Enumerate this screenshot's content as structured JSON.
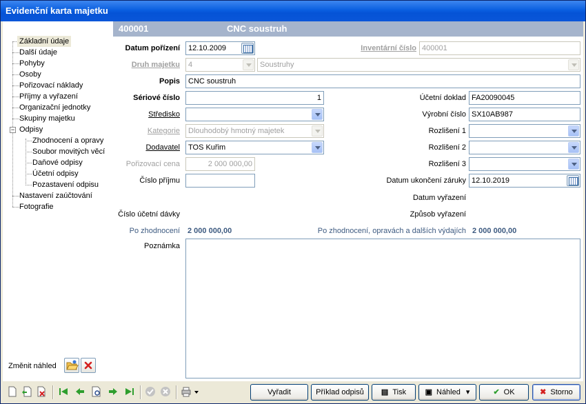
{
  "window": {
    "title": "Evidenční karta majetku"
  },
  "tree": {
    "items": [
      {
        "label": "Základní údaje",
        "selected": true
      },
      {
        "label": "Další údaje"
      },
      {
        "label": "Pohyby"
      },
      {
        "label": "Osoby"
      },
      {
        "label": "Pořizovací náklady"
      },
      {
        "label": "Příjmy a vyřazení"
      },
      {
        "label": "Organizační jednotky"
      },
      {
        "label": "Skupiny majetku"
      },
      {
        "label": "Odpisy",
        "expanded": true
      },
      {
        "label": "Zhodnocení a opravy"
      },
      {
        "label": "Soubor movitých věcí"
      },
      {
        "label": "Daňové odpisy"
      },
      {
        "label": "Účetní odpisy"
      },
      {
        "label": "Pozastavení odpisu"
      },
      {
        "label": "Nastavení zaúčtování"
      },
      {
        "label": "Fotografie"
      }
    ],
    "change_view_label": "Změnit náhled"
  },
  "header": {
    "number": "400001",
    "name": "CNC soustruh"
  },
  "form": {
    "datum_porizeni": {
      "label": "Datum pořízení",
      "value": "12.10.2009"
    },
    "inventarni_cislo": {
      "label": "Inventární číslo",
      "value": "400001"
    },
    "druh_majetku": {
      "label": "Druh majetku",
      "code": "4",
      "name": "Soustruhy"
    },
    "popis": {
      "label": "Popis",
      "value": "CNC soustruh"
    },
    "seriove_cislo": {
      "label": "Sériové číslo",
      "value": "1"
    },
    "ucetni_doklad": {
      "label": "Účetní doklad",
      "value": "FA20090045"
    },
    "stredisko": {
      "label": "Středisko",
      "value": ""
    },
    "vyrobni_cislo": {
      "label": "Výrobní číslo",
      "value": "SX10AB987"
    },
    "kategorie": {
      "label": "Kategorie",
      "value": "Dlouhodobý hmotný majetek"
    },
    "rozliseni1": {
      "label": "Rozlišení 1",
      "value": ""
    },
    "dodavatel": {
      "label": "Dodavatel",
      "value": "TOS Kuřim"
    },
    "rozliseni2": {
      "label": "Rozlišení 2",
      "value": ""
    },
    "porizovaci_cena": {
      "label": "Pořizovací cena",
      "value": "2 000 000,00"
    },
    "rozliseni3": {
      "label": "Rozlišení 3",
      "value": ""
    },
    "cislo_prijmu": {
      "label": "Číslo příjmu",
      "value": ""
    },
    "datum_ukonceni_zaruky": {
      "label": "Datum ukončení záruky",
      "value": "12.10.2019"
    },
    "datum_vyrazeni": {
      "label": "Datum vyřazení"
    },
    "zpusob_vyrazeni": {
      "label": "Způsob vyřazení"
    },
    "cislo_ucetni_davky": {
      "label": "Číslo účetní dávky"
    },
    "po_zhodnoceni": {
      "label": "Po zhodnocení",
      "value": "2 000 000,00"
    },
    "po_zhodnoceni_oprav": {
      "label": "Po zhodnocení, opravách a dalších výdajích",
      "value": "2 000 000,00"
    },
    "poznamka": {
      "label": "Poznámka",
      "value": ""
    }
  },
  "buttons": {
    "vyradit": "Vyřadit",
    "priklad_odpisu": "Příklad odpisů",
    "tisk": "Tisk",
    "nahled": "Náhled",
    "ok": "OK",
    "storno": "Storno"
  }
}
